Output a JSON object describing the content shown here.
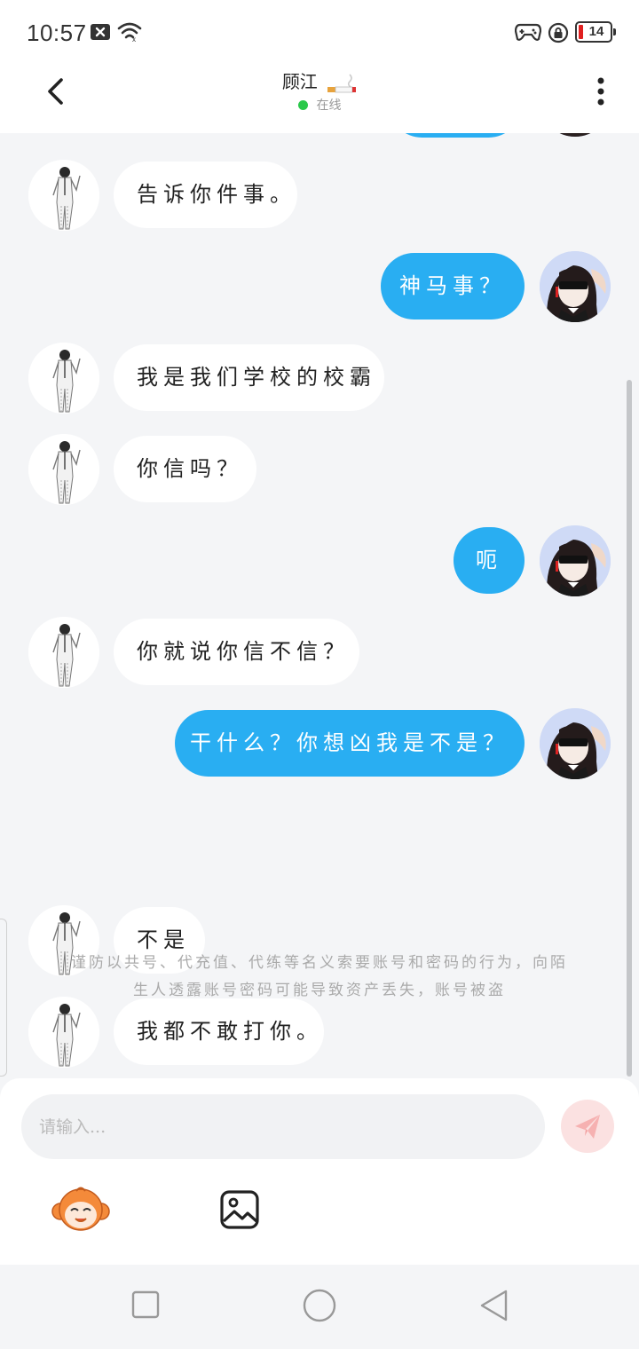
{
  "status_bar": {
    "time": "10:57",
    "battery": "14"
  },
  "header": {
    "title": "顾江",
    "status": "在线"
  },
  "messages": [
    {
      "side": "in",
      "text": "告诉你件事。"
    },
    {
      "side": "out",
      "text": "神马事？"
    },
    {
      "side": "in",
      "text": "我是我们学校的校霸"
    },
    {
      "side": "in",
      "text": "你信吗？"
    },
    {
      "side": "out",
      "text": "呃"
    },
    {
      "side": "in",
      "text": "你就说你信不信？"
    },
    {
      "side": "out",
      "text": "干什么？你想凶我是不是？"
    },
    {
      "side": "in",
      "text": "不是"
    },
    {
      "side": "in",
      "text": "我都不敢打你。"
    }
  ],
  "notice": {
    "line1": "谨防以共号、代充值、代练等名义索要账号和密码的行为，向陌",
    "line2": "生人透露账号密码可能导致资产丢失，账号被盗"
  },
  "composer": {
    "placeholder": "请输入..."
  },
  "colors": {
    "outgoing_bubble": "#29aef2",
    "online": "#2ac84a",
    "background": "#f4f5f7"
  }
}
